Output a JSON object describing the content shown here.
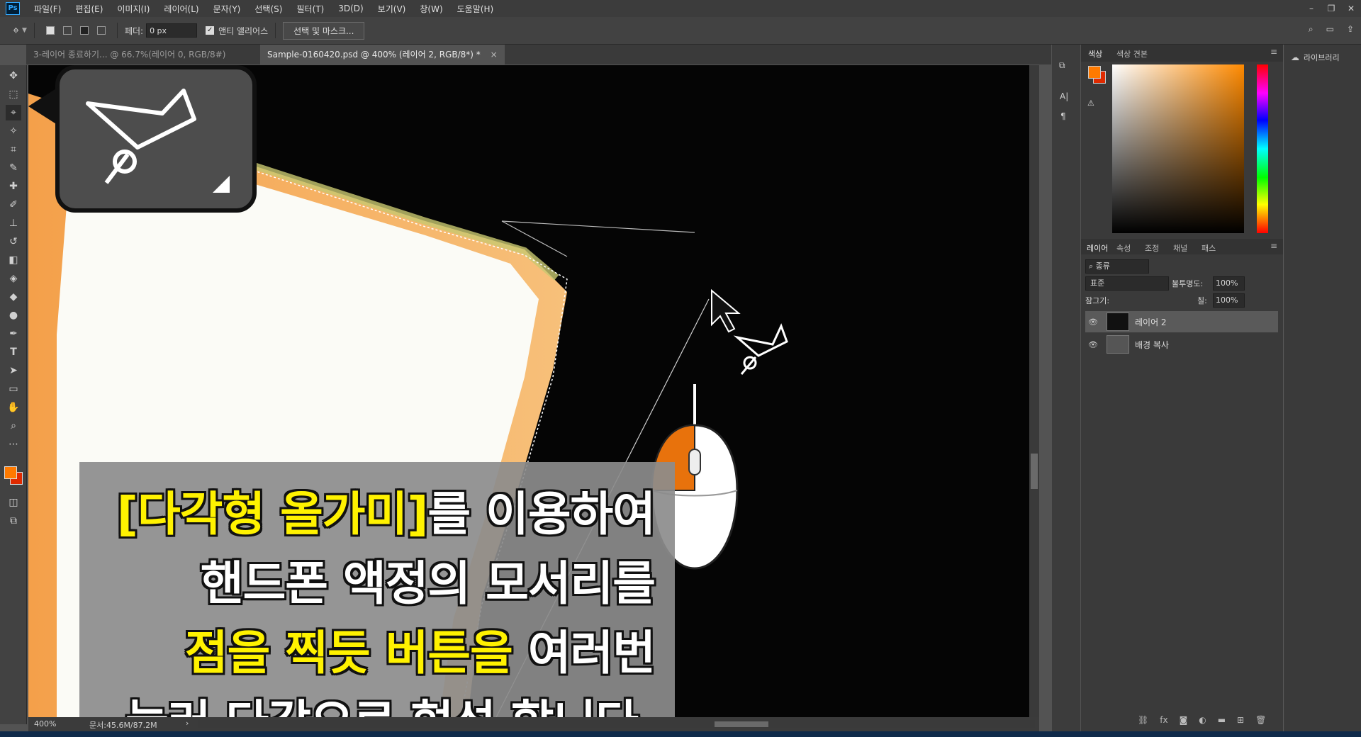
{
  "menubar": {
    "logo": "Ps",
    "items": [
      "파일(F)",
      "편집(E)",
      "이미지(I)",
      "레이어(L)",
      "문자(Y)",
      "선택(S)",
      "필터(T)",
      "3D(D)",
      "보기(V)",
      "창(W)",
      "도움말(H)"
    ]
  },
  "options": {
    "feather_label": "페더:",
    "feather_value": "0 px",
    "antialias_label": "앤티 앨리어스",
    "select_mask_label": "선택 및 마스크..."
  },
  "tabs": [
    {
      "label": "3-레이어 종료하기... @ 66.7%(레이어 0, RGB/8#)",
      "active": false
    },
    {
      "label": "Sample-0160420.psd @ 400% (레이어 2, RGB/8*) *",
      "active": true
    }
  ],
  "status": {
    "zoom": "400%",
    "doc": "문서:45.6M/87.2M"
  },
  "panels": {
    "color_tab": "색상",
    "swatch_tab": "색상 견본",
    "layers_tabs": [
      "레이어",
      "속성",
      "조정",
      "채널",
      "패스"
    ],
    "filter_kind": "종류",
    "blend_mode": "표준",
    "opacity_label": "불투명도:",
    "opacity_value": "100%",
    "lock_label": "잠그기:",
    "fill_label": "칠:",
    "fill_value": "100%",
    "layers": [
      {
        "name": "레이어 2",
        "selected": true
      },
      {
        "name": "배경 복사",
        "selected": false
      }
    ],
    "library_label": "라이브러리"
  },
  "caption": {
    "line1_highlight": "[다각형 올가미]",
    "line1_rest": "를 이용하여",
    "line2": "핸드폰 액정의 모서리를",
    "line3_highlight": "점을 찍듯 버튼을",
    "line3_rest": " 여러번",
    "line4": "눌러 다각으로 형성 합니다."
  },
  "colors": {
    "foreground": "#ff7a00",
    "background": "#e02a00",
    "caption_highlight": "#fff200",
    "mouse_left_button": "#e8720c"
  }
}
